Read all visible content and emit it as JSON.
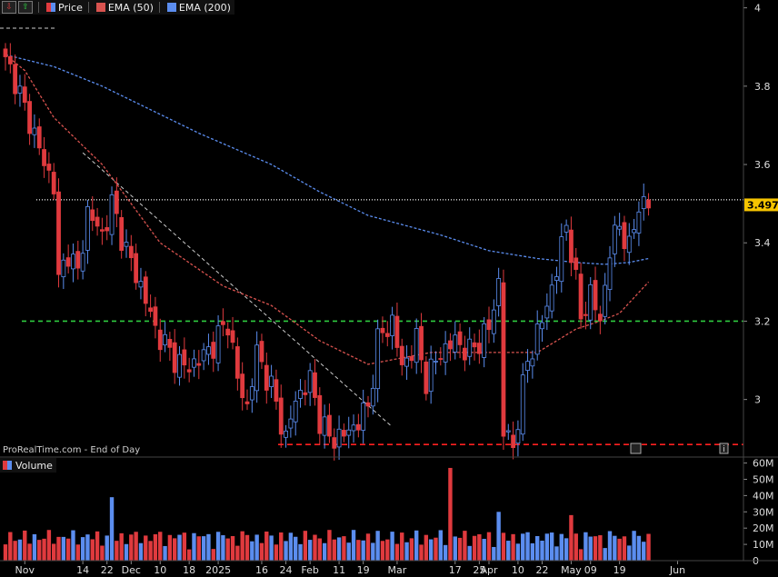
{
  "legend": {
    "price_label": "Price",
    "ema50_label": "EMA (50)",
    "ema200_label": "EMA (200)",
    "volume_label": "Volume"
  },
  "watermark": "ProRealTime.com - End of Day",
  "last_price_label": "3.497",
  "colors": {
    "up": "#5b8def",
    "down": "#e03a3e",
    "ema50": "#d9534f",
    "ema200": "#5b8def",
    "support": "#2ecc40",
    "low_support": "#ff2020",
    "background": "#000000"
  },
  "chart_data": {
    "type": "candlestick",
    "y_axis": {
      "ticks": [
        3.0,
        3.2,
        3.4,
        3.6,
        3.8,
        4.0
      ],
      "tick_labels": [
        "3",
        "3.2",
        "3.4",
        "3.6",
        "3.8",
        "4"
      ],
      "ylim": [
        2.86,
        4.02
      ]
    },
    "volume_axis": {
      "ticks": [
        0,
        10,
        20,
        30,
        40,
        50,
        60
      ],
      "tick_labels": [
        "0",
        "10M",
        "20M",
        "30M",
        "40M",
        "50M",
        "60M"
      ],
      "ylim": [
        0,
        62
      ]
    },
    "x_tick_labels": [
      "Nov",
      "14",
      "22",
      "Dec",
      "10",
      "18",
      "2025",
      "16",
      "24",
      "Feb",
      "11",
      "19",
      "Mar",
      "17",
      "25",
      "Apr",
      "10",
      "22",
      "May",
      "09",
      "19",
      "Jun"
    ],
    "x_tick_bars": [
      4,
      16,
      21,
      26,
      32,
      38,
      44,
      53,
      58,
      63,
      69,
      74,
      81,
      93,
      98,
      100,
      106,
      111,
      117,
      121,
      127,
      139
    ],
    "num_bars": 134,
    "last_price": 3.497,
    "horizontal_levels": [
      {
        "name": "resistance",
        "value": 3.51,
        "style": "dotted"
      },
      {
        "name": "support",
        "value": 3.2,
        "style": "dashed"
      },
      {
        "name": "low_support",
        "value": 2.885,
        "style": "dashed"
      }
    ],
    "trendline": {
      "from": {
        "bar": 16,
        "value": 3.63
      },
      "to": {
        "bar": 80,
        "value": 2.93
      }
    },
    "ema50": [
      [
        0,
        3.88
      ],
      [
        4,
        3.84
      ],
      [
        10,
        3.72
      ],
      [
        20,
        3.6
      ],
      [
        32,
        3.4
      ],
      [
        45,
        3.29
      ],
      [
        55,
        3.24
      ],
      [
        65,
        3.15
      ],
      [
        75,
        3.09
      ],
      [
        88,
        3.12
      ],
      [
        100,
        3.12
      ],
      [
        110,
        3.12
      ],
      [
        118,
        3.18
      ],
      [
        123,
        3.2
      ],
      [
        127,
        3.22
      ],
      [
        133,
        3.3
      ]
    ],
    "ema200": [
      [
        0,
        3.88
      ],
      [
        10,
        3.85
      ],
      [
        20,
        3.8
      ],
      [
        30,
        3.74
      ],
      [
        40,
        3.68
      ],
      [
        55,
        3.6
      ],
      [
        65,
        3.53
      ],
      [
        75,
        3.47
      ],
      [
        90,
        3.42
      ],
      [
        100,
        3.38
      ],
      [
        110,
        3.36
      ],
      [
        118,
        3.35
      ],
      [
        124,
        3.345
      ],
      [
        129,
        3.35
      ],
      [
        133,
        3.36
      ]
    ],
    "price_anchors": [
      [
        0,
        3.86
      ],
      [
        2,
        3.82
      ],
      [
        4,
        3.74
      ],
      [
        6,
        3.68
      ],
      [
        8,
        3.6
      ],
      [
        10,
        3.55
      ],
      [
        11,
        3.3
      ],
      [
        13,
        3.38
      ],
      [
        15,
        3.32
      ],
      [
        17,
        3.48
      ],
      [
        20,
        3.42
      ],
      [
        22,
        3.5
      ],
      [
        25,
        3.38
      ],
      [
        28,
        3.29
      ],
      [
        31,
        3.18
      ],
      [
        34,
        3.12
      ],
      [
        37,
        3.08
      ],
      [
        40,
        3.1
      ],
      [
        43,
        3.14
      ],
      [
        46,
        3.2
      ],
      [
        48,
        3.05
      ],
      [
        50,
        2.98
      ],
      [
        52,
        3.12
      ],
      [
        55,
        3.03
      ],
      [
        58,
        2.9
      ],
      [
        60,
        3.0
      ],
      [
        63,
        3.05
      ],
      [
        65,
        2.95
      ],
      [
        67,
        2.9
      ],
      [
        70,
        2.91
      ],
      [
        72,
        2.93
      ],
      [
        75,
        2.98
      ],
      [
        77,
        3.15
      ],
      [
        80,
        3.2
      ],
      [
        82,
        3.08
      ],
      [
        85,
        3.15
      ],
      [
        87,
        3.05
      ],
      [
        90,
        3.12
      ],
      [
        93,
        3.15
      ],
      [
        96,
        3.12
      ],
      [
        100,
        3.18
      ],
      [
        102,
        3.3
      ],
      [
        103,
        2.92
      ],
      [
        105,
        2.88
      ],
      [
        108,
        3.1
      ],
      [
        111,
        3.2
      ],
      [
        114,
        3.33
      ],
      [
        116,
        3.45
      ],
      [
        117,
        3.38
      ],
      [
        119,
        3.21
      ],
      [
        121,
        3.27
      ],
      [
        123,
        3.2
      ],
      [
        125,
        3.38
      ],
      [
        127,
        3.45
      ],
      [
        129,
        3.38
      ],
      [
        131,
        3.5
      ],
      [
        133,
        3.497
      ]
    ],
    "volume_spikes": [
      [
        22,
        39
      ],
      [
        92,
        57
      ],
      [
        102,
        30
      ],
      [
        117,
        28
      ]
    ]
  }
}
